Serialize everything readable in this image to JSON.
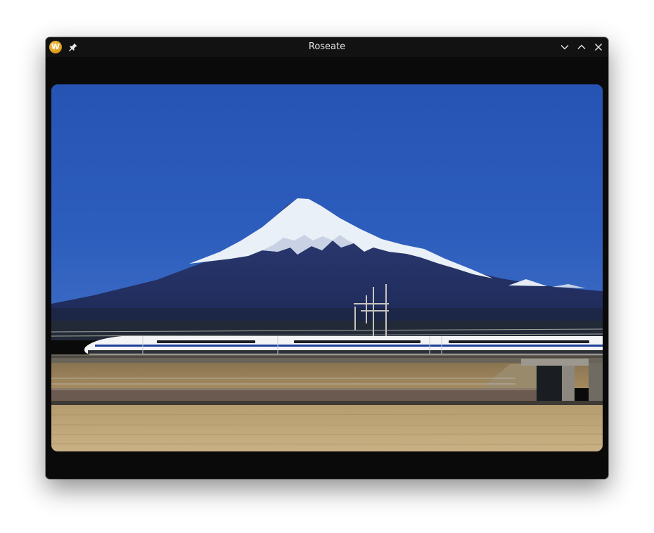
{
  "window": {
    "title": "Roseate",
    "app_icon_letter": "W",
    "icons": {
      "app": "roseate-app-icon",
      "pin": "pin-icon",
      "minimize": "chevron-down-icon",
      "maximize": "chevron-up-icon",
      "close": "close-icon"
    }
  },
  "image": {
    "description_icon": "photo-image"
  },
  "colors": {
    "titlebar": "#121212",
    "window_bg": "#0a0a0a",
    "sky": "#2c5ab8"
  }
}
